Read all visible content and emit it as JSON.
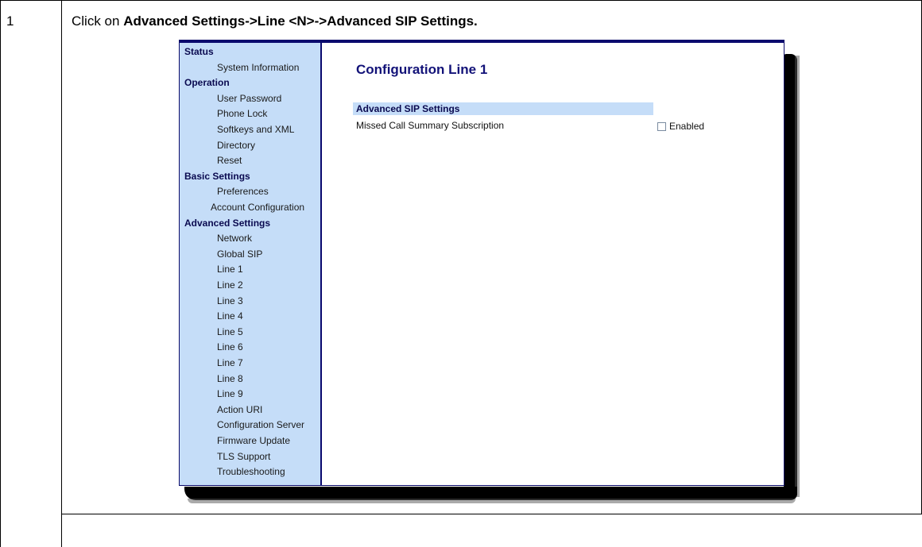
{
  "step": {
    "number": "1",
    "instruction_prefix": "Click on ",
    "instruction_bold": "Advanced Settings->Line <N>->Advanced SIP Settings."
  },
  "sidebar": {
    "items": [
      {
        "label": "Status",
        "type": "head"
      },
      {
        "label": "System Information",
        "type": "sub"
      },
      {
        "label": "Operation",
        "type": "head"
      },
      {
        "label": "User Password",
        "type": "sub"
      },
      {
        "label": "Phone Lock",
        "type": "sub"
      },
      {
        "label": "Softkeys and XML",
        "type": "sub"
      },
      {
        "label": "Directory",
        "type": "sub"
      },
      {
        "label": "Reset",
        "type": "sub"
      },
      {
        "label": "Basic Settings",
        "type": "head"
      },
      {
        "label": "Preferences",
        "type": "sub"
      },
      {
        "label": "Account Configuration",
        "type": "sub2"
      },
      {
        "label": "Advanced Settings",
        "type": "head"
      },
      {
        "label": "Network",
        "type": "sub"
      },
      {
        "label": "Global SIP",
        "type": "sub"
      },
      {
        "label": "Line 1",
        "type": "sub"
      },
      {
        "label": "Line 2",
        "type": "sub"
      },
      {
        "label": "Line 3",
        "type": "sub"
      },
      {
        "label": "Line 4",
        "type": "sub"
      },
      {
        "label": "Line 5",
        "type": "sub"
      },
      {
        "label": "Line 6",
        "type": "sub"
      },
      {
        "label": "Line 7",
        "type": "sub"
      },
      {
        "label": "Line 8",
        "type": "sub"
      },
      {
        "label": "Line 9",
        "type": "sub"
      },
      {
        "label": "Action URI",
        "type": "sub"
      },
      {
        "label": "Configuration Server",
        "type": "sub"
      },
      {
        "label": "Firmware Update",
        "type": "sub"
      },
      {
        "label": "TLS Support",
        "type": "sub"
      },
      {
        "label": "Troubleshooting",
        "type": "sub"
      }
    ]
  },
  "main": {
    "title": "Configuration Line 1",
    "section_title": "Advanced SIP Settings",
    "field_label": "Missed Call Summary Subscription",
    "checkbox_label": "Enabled",
    "checkbox_checked": false
  },
  "colors": {
    "sidebar_bg": "#c5ddf8",
    "accent": "#0a0a6e",
    "title_color": "#121278"
  }
}
